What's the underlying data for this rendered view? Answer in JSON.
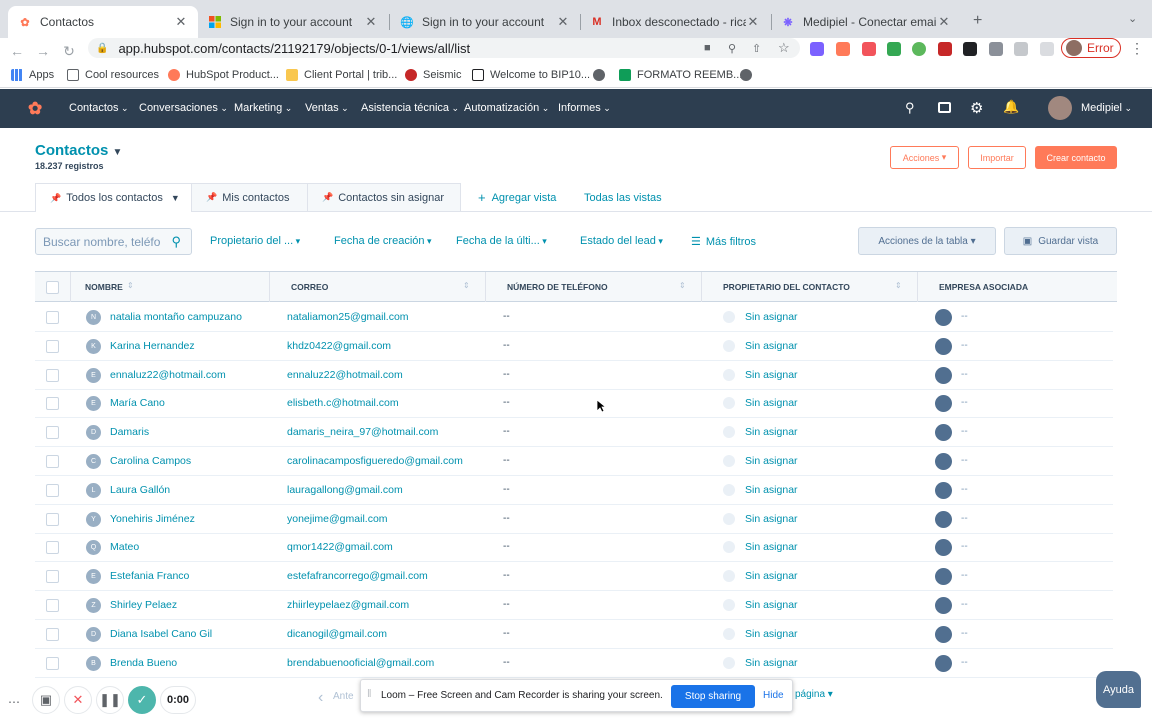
{
  "browser": {
    "tabs": [
      {
        "title": "Contactos",
        "icon": "hubspot-icon"
      },
      {
        "title": "Sign in to your account",
        "icon": "microsoft-icon"
      },
      {
        "title": "Sign in to your account",
        "icon": "globe-icon"
      },
      {
        "title": "Inbox desconectado - ricardo@",
        "icon": "gmail-icon"
      },
      {
        "title": "Medipiel - Conectar emails al",
        "icon": "medipiel-icon"
      }
    ],
    "url": "app.hubspot.com/contacts/21192179/objects/0-1/views/all/list",
    "error_label": "Error",
    "bookmarks": [
      {
        "label": "Apps",
        "icon": "apps-grid-icon"
      },
      {
        "label": "Cool resources",
        "icon": "folder-icon"
      },
      {
        "label": "HubSpot Product...",
        "icon": "hubspot-icon"
      },
      {
        "label": "Client Portal | trib...",
        "icon": "portal-icon"
      },
      {
        "label": "Seismic",
        "icon": "seismic-icon"
      },
      {
        "label": "Welcome to BIP10...",
        "icon": "notion-icon"
      },
      {
        "label": "",
        "icon": "globe-icon"
      },
      {
        "label": "FORMATO REEMB...",
        "icon": "sheets-icon"
      },
      {
        "label": "",
        "icon": "globe-icon"
      }
    ]
  },
  "nav": {
    "items": [
      "Contactos",
      "Conversaciones",
      "Marketing",
      "Ventas",
      "Asistencia técnica",
      "Automatización",
      "Informes"
    ],
    "account": "Medipiel"
  },
  "page": {
    "title": "Contactos",
    "count": "18.237 registros",
    "actions_label": "Acciones",
    "import_label": "Importar",
    "create_label": "Crear contacto"
  },
  "views": {
    "tabs": [
      "Todos los contactos",
      "Mis contactos",
      "Contactos sin asignar"
    ],
    "add_view": "Agregar vista",
    "all_views": "Todas las vistas"
  },
  "filters": {
    "search_placeholder": "Buscar nombre, teléfo",
    "items": [
      "Propietario del ...",
      "Fecha de creación",
      "Fecha de la últi...",
      "Estado del lead"
    ],
    "more_filters": "Más filtros",
    "table_actions": "Acciones de la tabla",
    "save_view": "Guardar vista"
  },
  "table": {
    "columns": [
      "NOMBRE",
      "CORREO",
      "NÚMERO DE TELÉFONO",
      "PROPIETARIO DEL CONTACTO",
      "EMPRESA ASOCIADA"
    ],
    "rows": [
      {
        "initial": "N",
        "name": "natalia montaño campuzano",
        "email": "nataliamon25@gmail.com",
        "phone": "--",
        "owner": "Sin asignar",
        "company": "--"
      },
      {
        "initial": "K",
        "name": "Karina Hernandez",
        "email": "khdz0422@gmail.com",
        "phone": "--",
        "owner": "Sin asignar",
        "company": "--"
      },
      {
        "initial": "E",
        "name": "ennaluz22@hotmail.com",
        "email": "ennaluz22@hotmail.com",
        "phone": "--",
        "owner": "Sin asignar",
        "company": "--"
      },
      {
        "initial": "E",
        "name": "María Cano",
        "email": "elisbeth.c@hotmail.com",
        "phone": "--",
        "owner": "Sin asignar",
        "company": "--"
      },
      {
        "initial": "D",
        "name": "Damaris",
        "email": "damaris_neira_97@hotmail.com",
        "phone": "--",
        "owner": "Sin asignar",
        "company": "--"
      },
      {
        "initial": "C",
        "name": "Carolina Campos",
        "email": "carolinacamposfigueredo@gmail.com",
        "phone": "--",
        "owner": "Sin asignar",
        "company": "--"
      },
      {
        "initial": "L",
        "name": "Laura Gallón",
        "email": "lauragallong@gmail.com",
        "phone": "--",
        "owner": "Sin asignar",
        "company": "--"
      },
      {
        "initial": "Y",
        "name": "Yonehiris Jiménez",
        "email": "yonejime@gmail.com",
        "phone": "--",
        "owner": "Sin asignar",
        "company": "--"
      },
      {
        "initial": "Q",
        "name": "Mateo",
        "email": "qmor1422@gmail.com",
        "phone": "--",
        "owner": "Sin asignar",
        "company": "--"
      },
      {
        "initial": "E",
        "name": "Estefania Franco",
        "email": "estefafrancorrego@gmail.com",
        "phone": "--",
        "owner": "Sin asignar",
        "company": "--"
      },
      {
        "initial": "Z",
        "name": "Shirley Pelaez",
        "email": "zhiirleypelaez@gmail.com",
        "phone": "--",
        "owner": "Sin asignar",
        "company": "--"
      },
      {
        "initial": "D",
        "name": "Diana Isabel Cano Gil",
        "email": "dicanogil@gmail.com",
        "phone": "--",
        "owner": "Sin asignar",
        "company": "--"
      },
      {
        "initial": "B",
        "name": "Brenda Bueno",
        "email": "brendabuenooficial@gmail.com",
        "phone": "--",
        "owner": "Sin asignar",
        "company": "--"
      }
    ]
  },
  "pagination": {
    "prev": "Ante",
    "page_size": "página"
  },
  "loom": {
    "timer": "0:00",
    "share_message": "Loom – Free Screen and Cam Recorder is sharing your screen.",
    "stop_label": "Stop sharing",
    "hide_label": "Hide"
  },
  "help_label": "Ayuda",
  "colors": {
    "brand": "#0091ae",
    "nav": "#2d3e50",
    "create": "#ff7a59"
  }
}
